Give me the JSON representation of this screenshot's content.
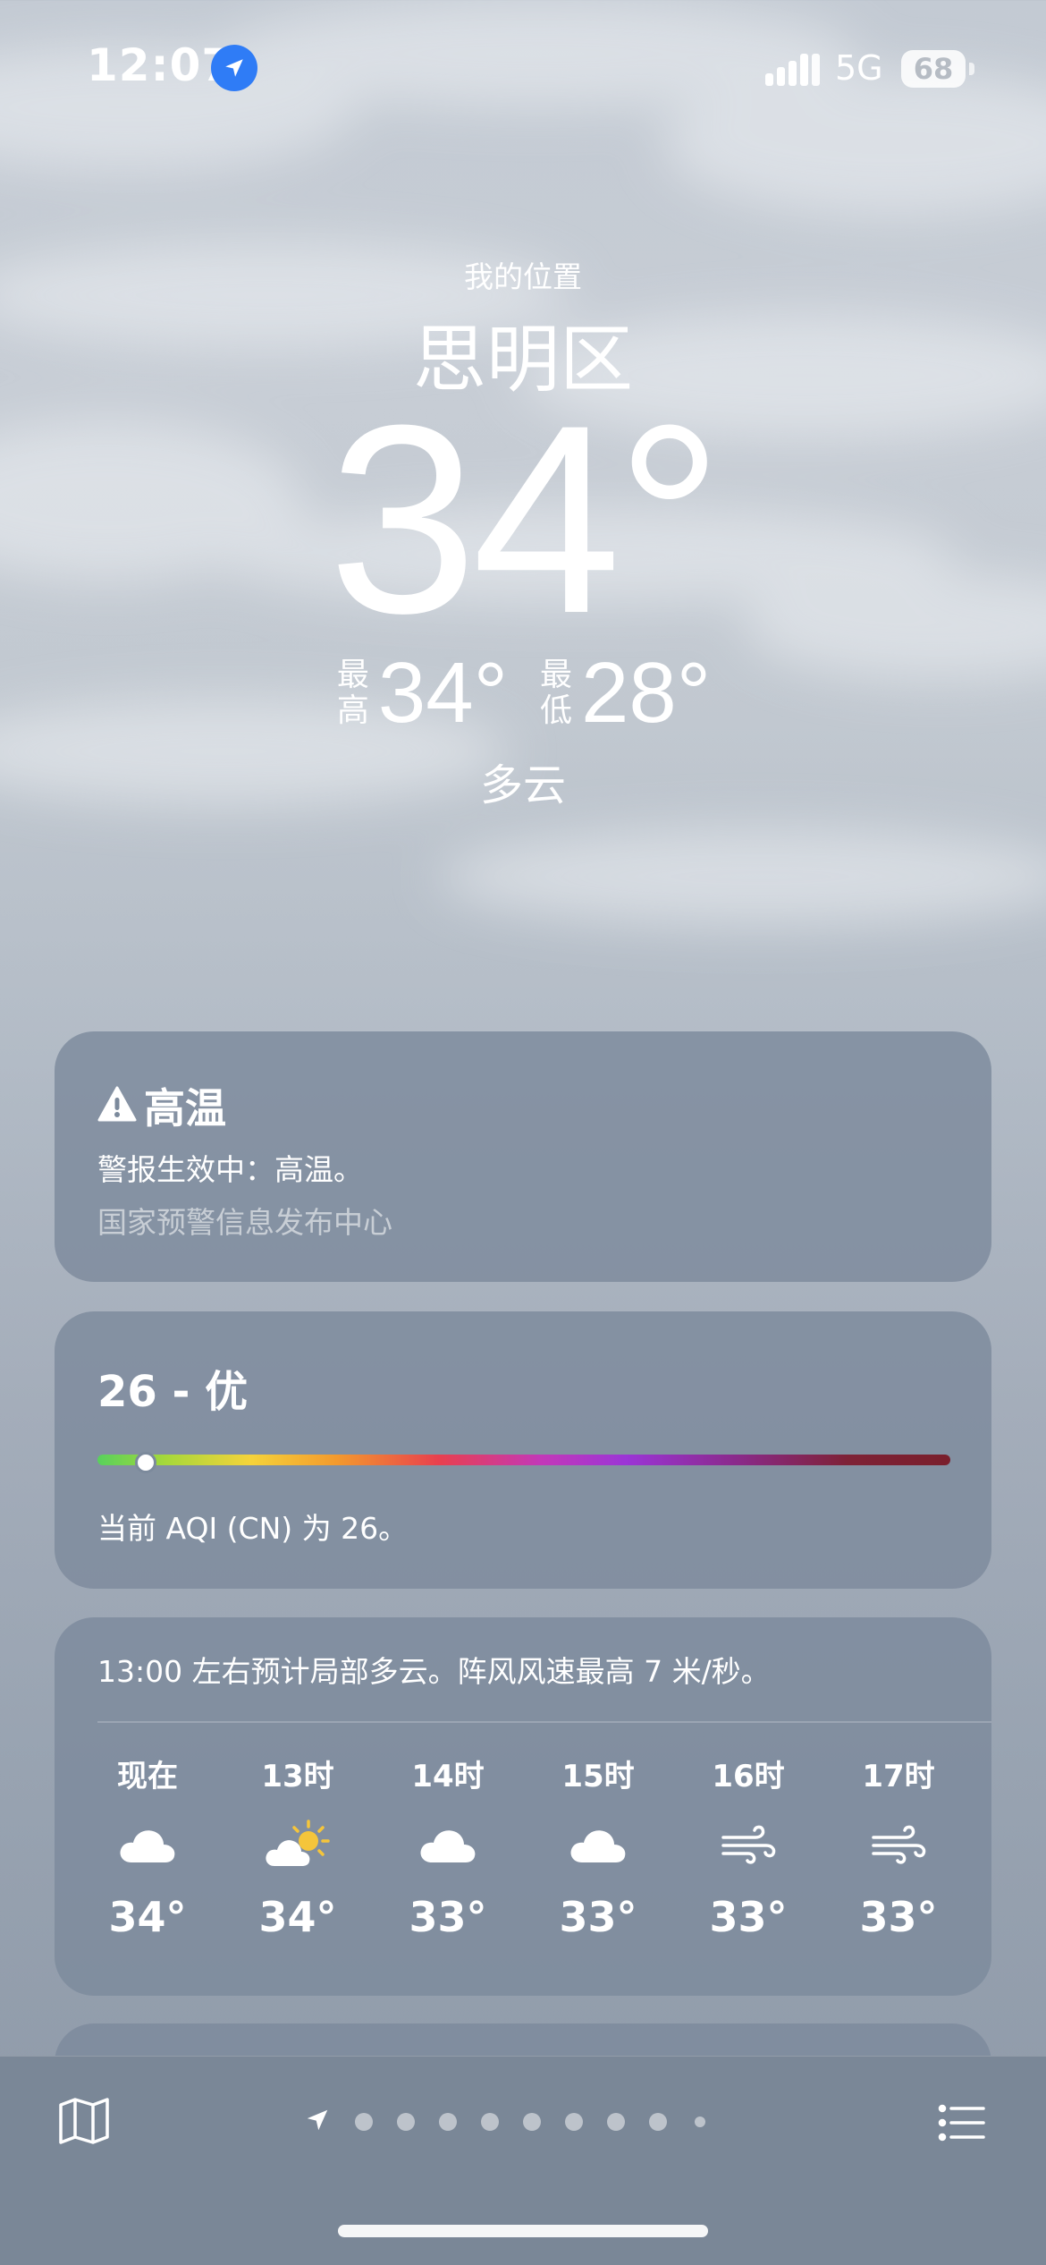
{
  "status_bar": {
    "time": "12:07",
    "network": "5G",
    "battery": "68",
    "location_icon": "location-arrow-icon",
    "signal_icon": "signal-bars-icon"
  },
  "hero": {
    "label": "我的位置",
    "city": "思明区",
    "temperature": "34°",
    "high_label": "最高",
    "high_value": "34°",
    "low_label": "最低",
    "low_value": "28°",
    "condition": "多云"
  },
  "alert_card": {
    "icon": "warning-triangle-icon",
    "title": "高温",
    "body": "警报生效中：高温。",
    "source": "国家预警信息发布中心"
  },
  "aqi_card": {
    "title": "26 - 优",
    "level": 0.057,
    "description": "当前 AQI (CN) 为 26。",
    "gradient_colors": [
      "#58d15c",
      "#f5d33a",
      "#f39a2d",
      "#e8404e",
      "#c338b8",
      "#9b35d6",
      "#7a1f2c"
    ]
  },
  "hourly_card": {
    "summary": "13:00 左右预计局部多云。阵风风速最高 7 米/秒。",
    "hours": [
      {
        "label": "现在",
        "icon": "cloud-icon",
        "temp": "34°"
      },
      {
        "label": "13时",
        "icon": "partly-sunny-icon",
        "temp": "34°"
      },
      {
        "label": "14时",
        "icon": "cloud-icon",
        "temp": "33°"
      },
      {
        "label": "15时",
        "icon": "cloud-icon",
        "temp": "33°"
      },
      {
        "label": "16时",
        "icon": "wind-icon",
        "temp": "33°"
      },
      {
        "label": "17时",
        "icon": "wind-icon",
        "temp": "33°"
      }
    ]
  },
  "toolbar": {
    "map_icon": "map-icon",
    "list_icon": "list-icon",
    "current_location_icon": "location-arrow-icon",
    "page_count": 9,
    "active_page": 0
  },
  "colors": {
    "card_bg": "#7c8a9c",
    "toolbar_bg": "#7a8797",
    "location_badge": "#2f7cf6"
  }
}
